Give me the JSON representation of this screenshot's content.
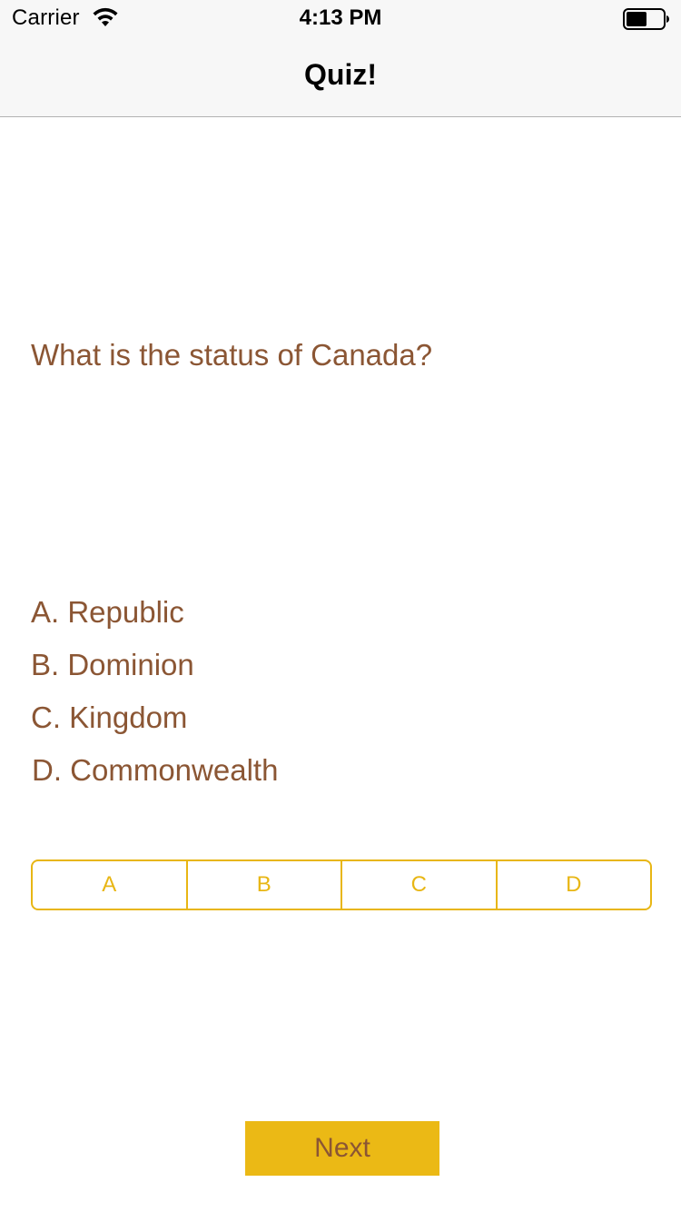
{
  "status_bar": {
    "carrier": "Carrier",
    "time": "4:13 PM",
    "icons": [
      "wifi-icon",
      "battery-icon"
    ]
  },
  "nav": {
    "title": "Quiz!"
  },
  "quiz": {
    "question": "What is the status of Canada?",
    "options": [
      "A. Republic",
      "B. Dominion",
      "C. Kingdom",
      "D. Commonwealth"
    ],
    "answer_segments": [
      "A",
      "B",
      "C",
      "D"
    ],
    "next_label": "Next"
  },
  "colors": {
    "text_brown": "#8b5634",
    "accent_yellow": "#e8b614",
    "button_yellow": "#ebb915",
    "bar_background": "#f7f7f7"
  }
}
